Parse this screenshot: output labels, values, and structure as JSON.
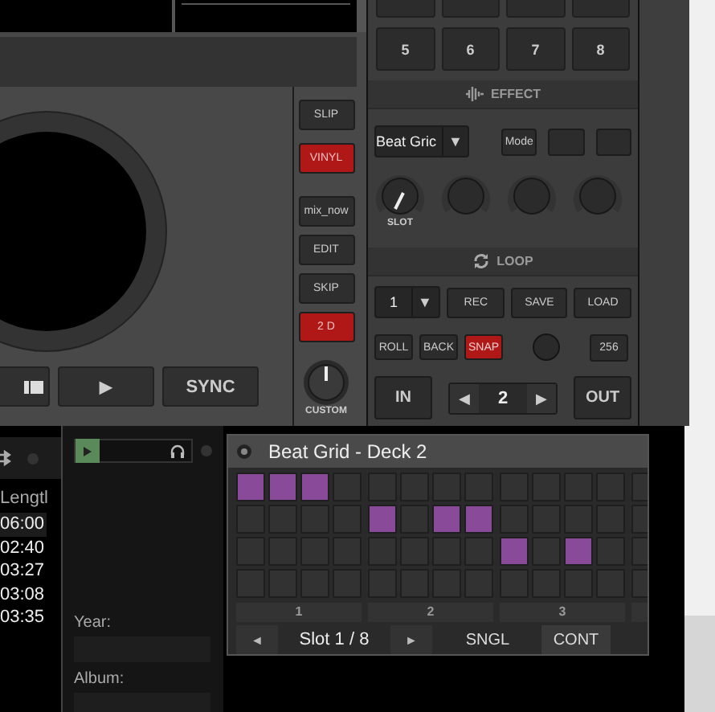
{
  "deck": {
    "side_buttons": [
      {
        "label": "SLIP",
        "on": false
      },
      {
        "label": "VINYL",
        "on": true
      },
      {
        "label": "mix_now",
        "on": false
      },
      {
        "label": "EDIT",
        "on": false
      },
      {
        "label": "SKIP",
        "on": false
      },
      {
        "label": "2 D",
        "on": true
      }
    ],
    "custom_knob": "CUSTOM",
    "play": "▶",
    "sync": "SYNC"
  },
  "pads": [
    "5",
    "6",
    "7",
    "8"
  ],
  "effect": {
    "title": "EFFECT",
    "selector": "Beat Gric",
    "selector_arrow": "▼",
    "mode": "Mode",
    "knob_label": "SLOT"
  },
  "loop": {
    "title": "LOOP",
    "size": "1",
    "size_arrow": "▼",
    "buttons": [
      "REC",
      "SAVE",
      "LOAD"
    ],
    "toggles": [
      {
        "label": "ROLL",
        "on": false
      },
      {
        "label": "BACK",
        "on": false
      },
      {
        "label": "SNAP",
        "on": true
      }
    ],
    "value": "256",
    "in": "IN",
    "prev": "◀",
    "count": "2",
    "next": "▶",
    "out": "OUT"
  },
  "browser": {
    "column": "Lengtl",
    "rows": [
      {
        "length": "06:00",
        "selected": true
      },
      {
        "length": "02:40",
        "selected": false
      },
      {
        "length": "03:27",
        "selected": false
      },
      {
        "length": "03:08",
        "selected": false
      },
      {
        "length": "03:35",
        "selected": false
      }
    ]
  },
  "info": {
    "fields": [
      {
        "label": "Year:"
      },
      {
        "label": "Album:"
      }
    ]
  },
  "beat_grid": {
    "title": "Beat Grid - Deck 2",
    "groups": [
      {
        "label": "1",
        "steps": [
          [
            true,
            true,
            true,
            false
          ],
          [
            false,
            false,
            false,
            false
          ],
          [
            false,
            false,
            false,
            false
          ],
          [
            false,
            false,
            false,
            false
          ]
        ]
      },
      {
        "label": "2",
        "steps": [
          [
            false,
            false,
            false,
            false
          ],
          [
            true,
            false,
            true,
            true
          ],
          [
            false,
            false,
            false,
            false
          ],
          [
            false,
            false,
            false,
            false
          ]
        ]
      },
      {
        "label": "3",
        "steps": [
          [
            false,
            false,
            false,
            false
          ],
          [
            false,
            false,
            false,
            false
          ],
          [
            true,
            false,
            true,
            false
          ],
          [
            false,
            false,
            false,
            false
          ]
        ]
      },
      {
        "steps": [
          [
            false
          ],
          [
            false
          ],
          [
            false
          ],
          [
            false
          ]
        ]
      }
    ],
    "prev": "◄",
    "slot": "Slot 1 / 8",
    "next": "►",
    "modes": [
      {
        "label": "SNGL",
        "selected": false
      },
      {
        "label": "CONT",
        "selected": true
      }
    ]
  }
}
